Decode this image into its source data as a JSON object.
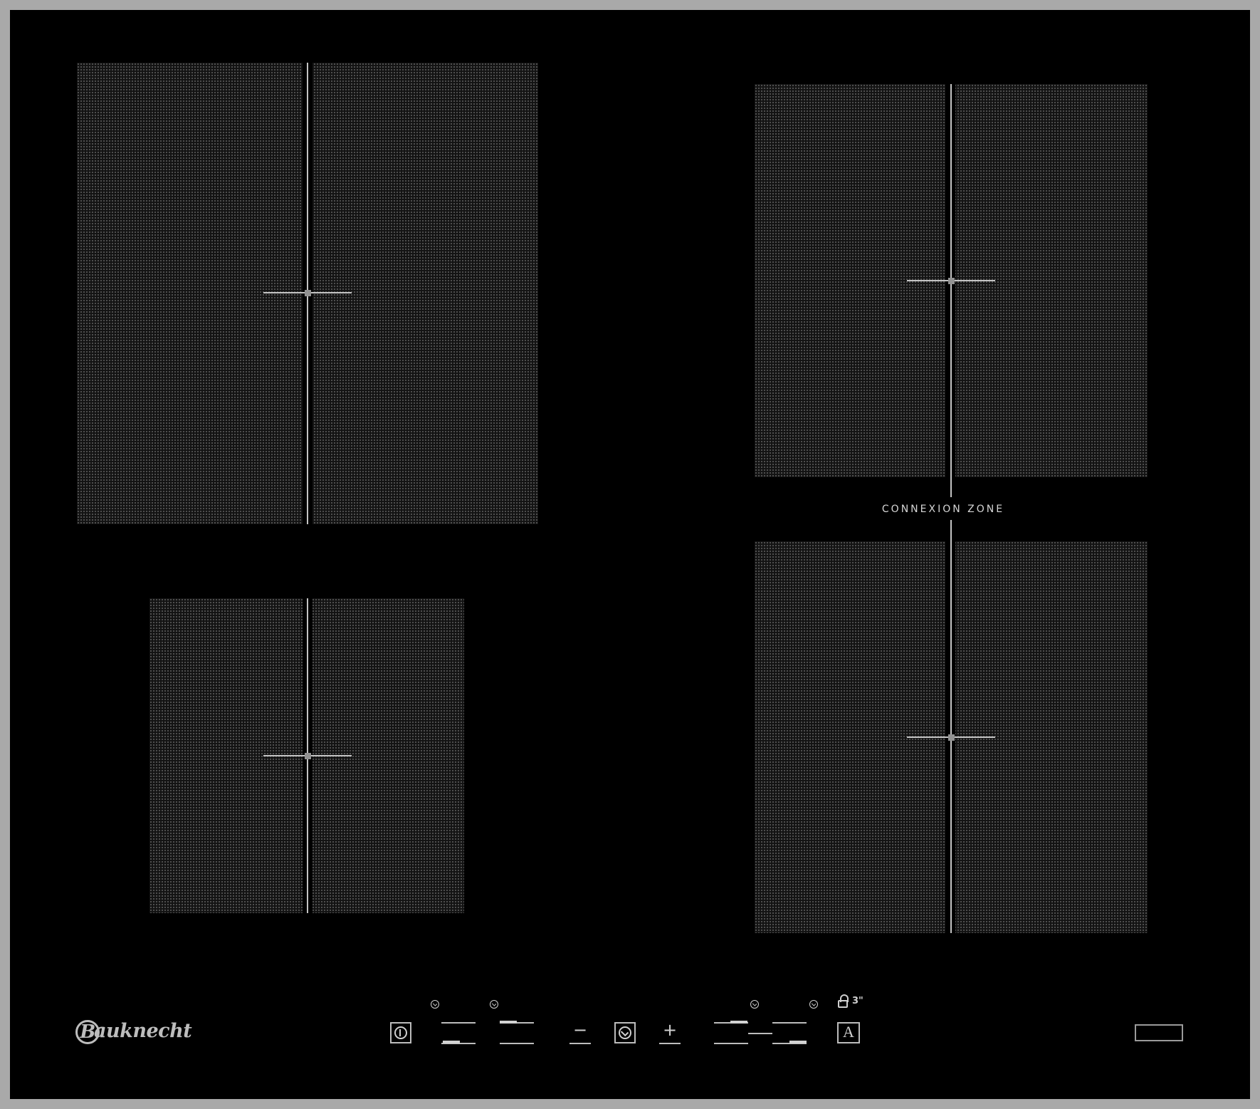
{
  "appliance": {
    "type": "induction hob",
    "colors": {
      "glass": "#000000",
      "frame": "#a9a9a9",
      "zone_pattern": "#5a5a5a",
      "markings": "#cfcfcf"
    }
  },
  "cooking_zones": [
    {
      "name": "front-left",
      "icon": "cooking-zone"
    },
    {
      "name": "rear-left",
      "icon": "cooking-zone"
    },
    {
      "name": "rear-right",
      "icon": "cooking-zone"
    },
    {
      "name": "front-right",
      "icon": "cooking-zone"
    }
  ],
  "labels": {
    "connexion_zone": "CONNEXION ZONE",
    "brand": "Bauknecht",
    "brand_initial": "B",
    "brand_rest": "auknecht",
    "lock_timer": "3\"",
    "auto_label": "A"
  },
  "controls": {
    "power": {
      "icon": "power-icon"
    },
    "minus": {
      "label": "−",
      "icon": "minus-icon"
    },
    "timer": {
      "icon": "timer-icon"
    },
    "plus": {
      "label": "+",
      "icon": "plus-icon"
    }
  }
}
